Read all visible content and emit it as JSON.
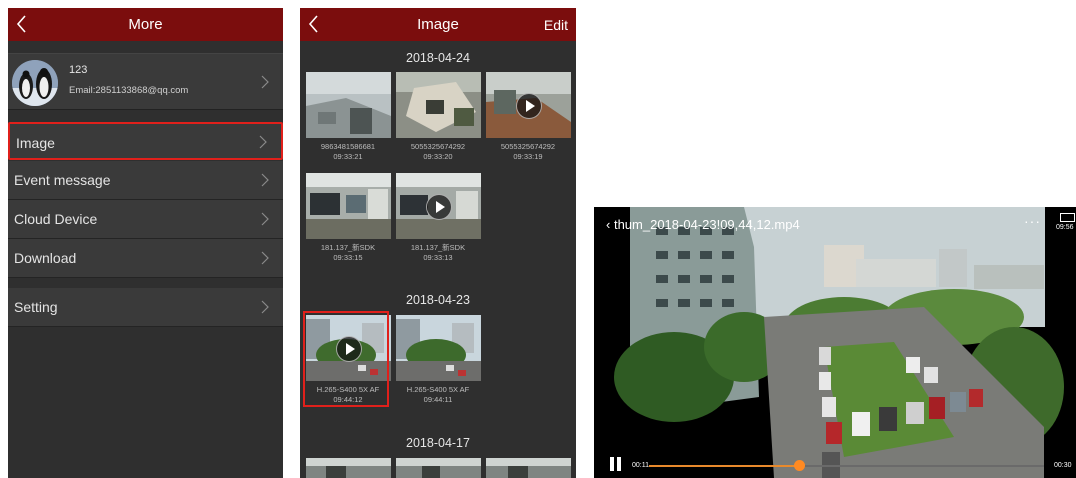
{
  "more_screen": {
    "title": "More",
    "profile": {
      "name": "123",
      "email": "Email:2851133868@qq.com"
    },
    "menu_items": [
      {
        "label": "Image",
        "highlighted": true
      },
      {
        "label": "Event message"
      },
      {
        "label": "Cloud Device"
      },
      {
        "label": "Download"
      },
      {
        "label": "Setting"
      }
    ]
  },
  "image_screen": {
    "title": "Image",
    "edit_label": "Edit",
    "groups": [
      {
        "date": "2018-04-24",
        "items": [
          {
            "name": "9863481586681",
            "time": "09:33:21",
            "video": false
          },
          {
            "name": "5055325674292",
            "time": "09:33:20",
            "video": false
          },
          {
            "name": "5055325674292",
            "time": "09:33:19",
            "video": true
          },
          {
            "name": "181.137_新SDK",
            "time": "09:33:15",
            "video": false
          },
          {
            "name": "181.137_新SDK",
            "time": "09:33:13",
            "video": true
          }
        ]
      },
      {
        "date": "2018-04-23",
        "items": [
          {
            "name": "H.265-S400 5X AF",
            "time": "09:44:12",
            "video": true,
            "selected": true
          },
          {
            "name": "H.265-S400 5X AF",
            "time": "09:44:11",
            "video": false
          }
        ]
      },
      {
        "date": "2018-04-17",
        "items": []
      }
    ]
  },
  "video_player": {
    "filename": "thum_2018-04-23!09,44,12.mp4",
    "more_icon_label": "···",
    "clock": "09:56",
    "current_time": "00:11",
    "end_time": "00:30",
    "progress": 0.38
  },
  "colors": {
    "header": "#7b0d0d",
    "highlight": "#e0201b",
    "progress": "#ff8a22"
  }
}
